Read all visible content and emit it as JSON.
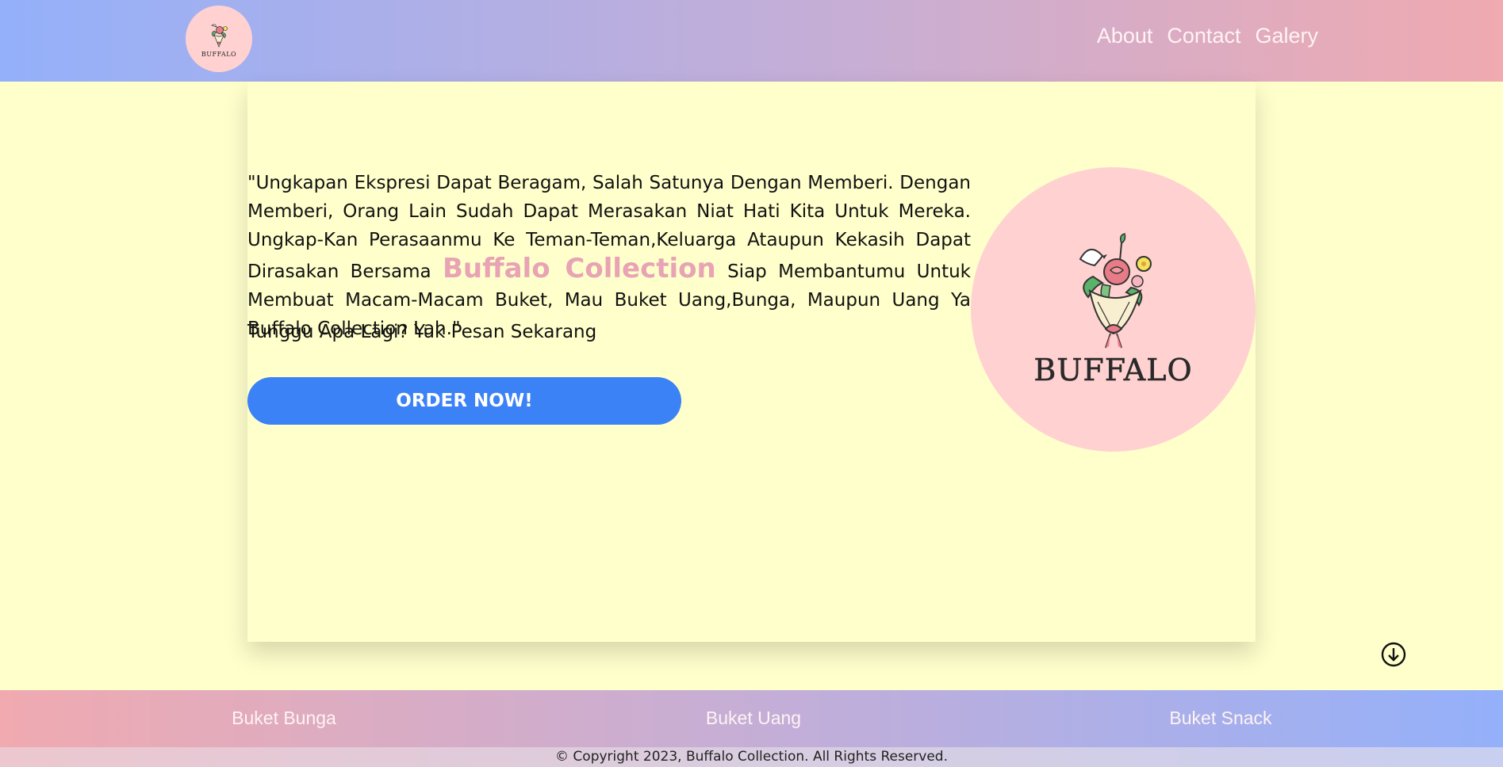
{
  "header": {
    "logo_text": "BUFFALO",
    "nav": [
      "About",
      "Contact",
      "Galery"
    ]
  },
  "hero": {
    "quote_part1": "\"Ungkapan Ekspresi Dapat Beragam, Salah Satunya Dengan Memberi. Dengan Memberi, Orang Lain Sudah Dapat Merasakan Niat Hati Kita Untuk Mereka. Ungkap-Kan Perasaanmu Ke Teman-Teman,Keluarga Ataupun Kekasih Dapat Dirasakan Bersama",
    "brand_highlight": "Buffalo Collection",
    "quote_part2": "Siap Membantumu Untuk Membuat Macam-Macam Buket, Mau Buket Uang,Bunga, Maupun Uang Ya Buffalo Collection Lah.\"",
    "cta_line": "Tunggu Apa Lagi? Yuk Pesan Sekarang",
    "order_button": "ORDER NOW!",
    "logo_text": "BUFFALO"
  },
  "categories": [
    "Buket Bunga",
    "Buket Uang",
    "Buket Snack"
  ],
  "footer": {
    "copyright": "© Copyright 2023, Buffalo Collection. All Rights Reserved."
  },
  "icons": {
    "scroll": "arrow-down-circle-icon",
    "logo": "bouquet-icon"
  },
  "colors": {
    "page_bg": "#ffffcc",
    "button": "#3b82f6",
    "highlight": "#e8a3b4",
    "logo_circle": "#ffd1d1"
  }
}
